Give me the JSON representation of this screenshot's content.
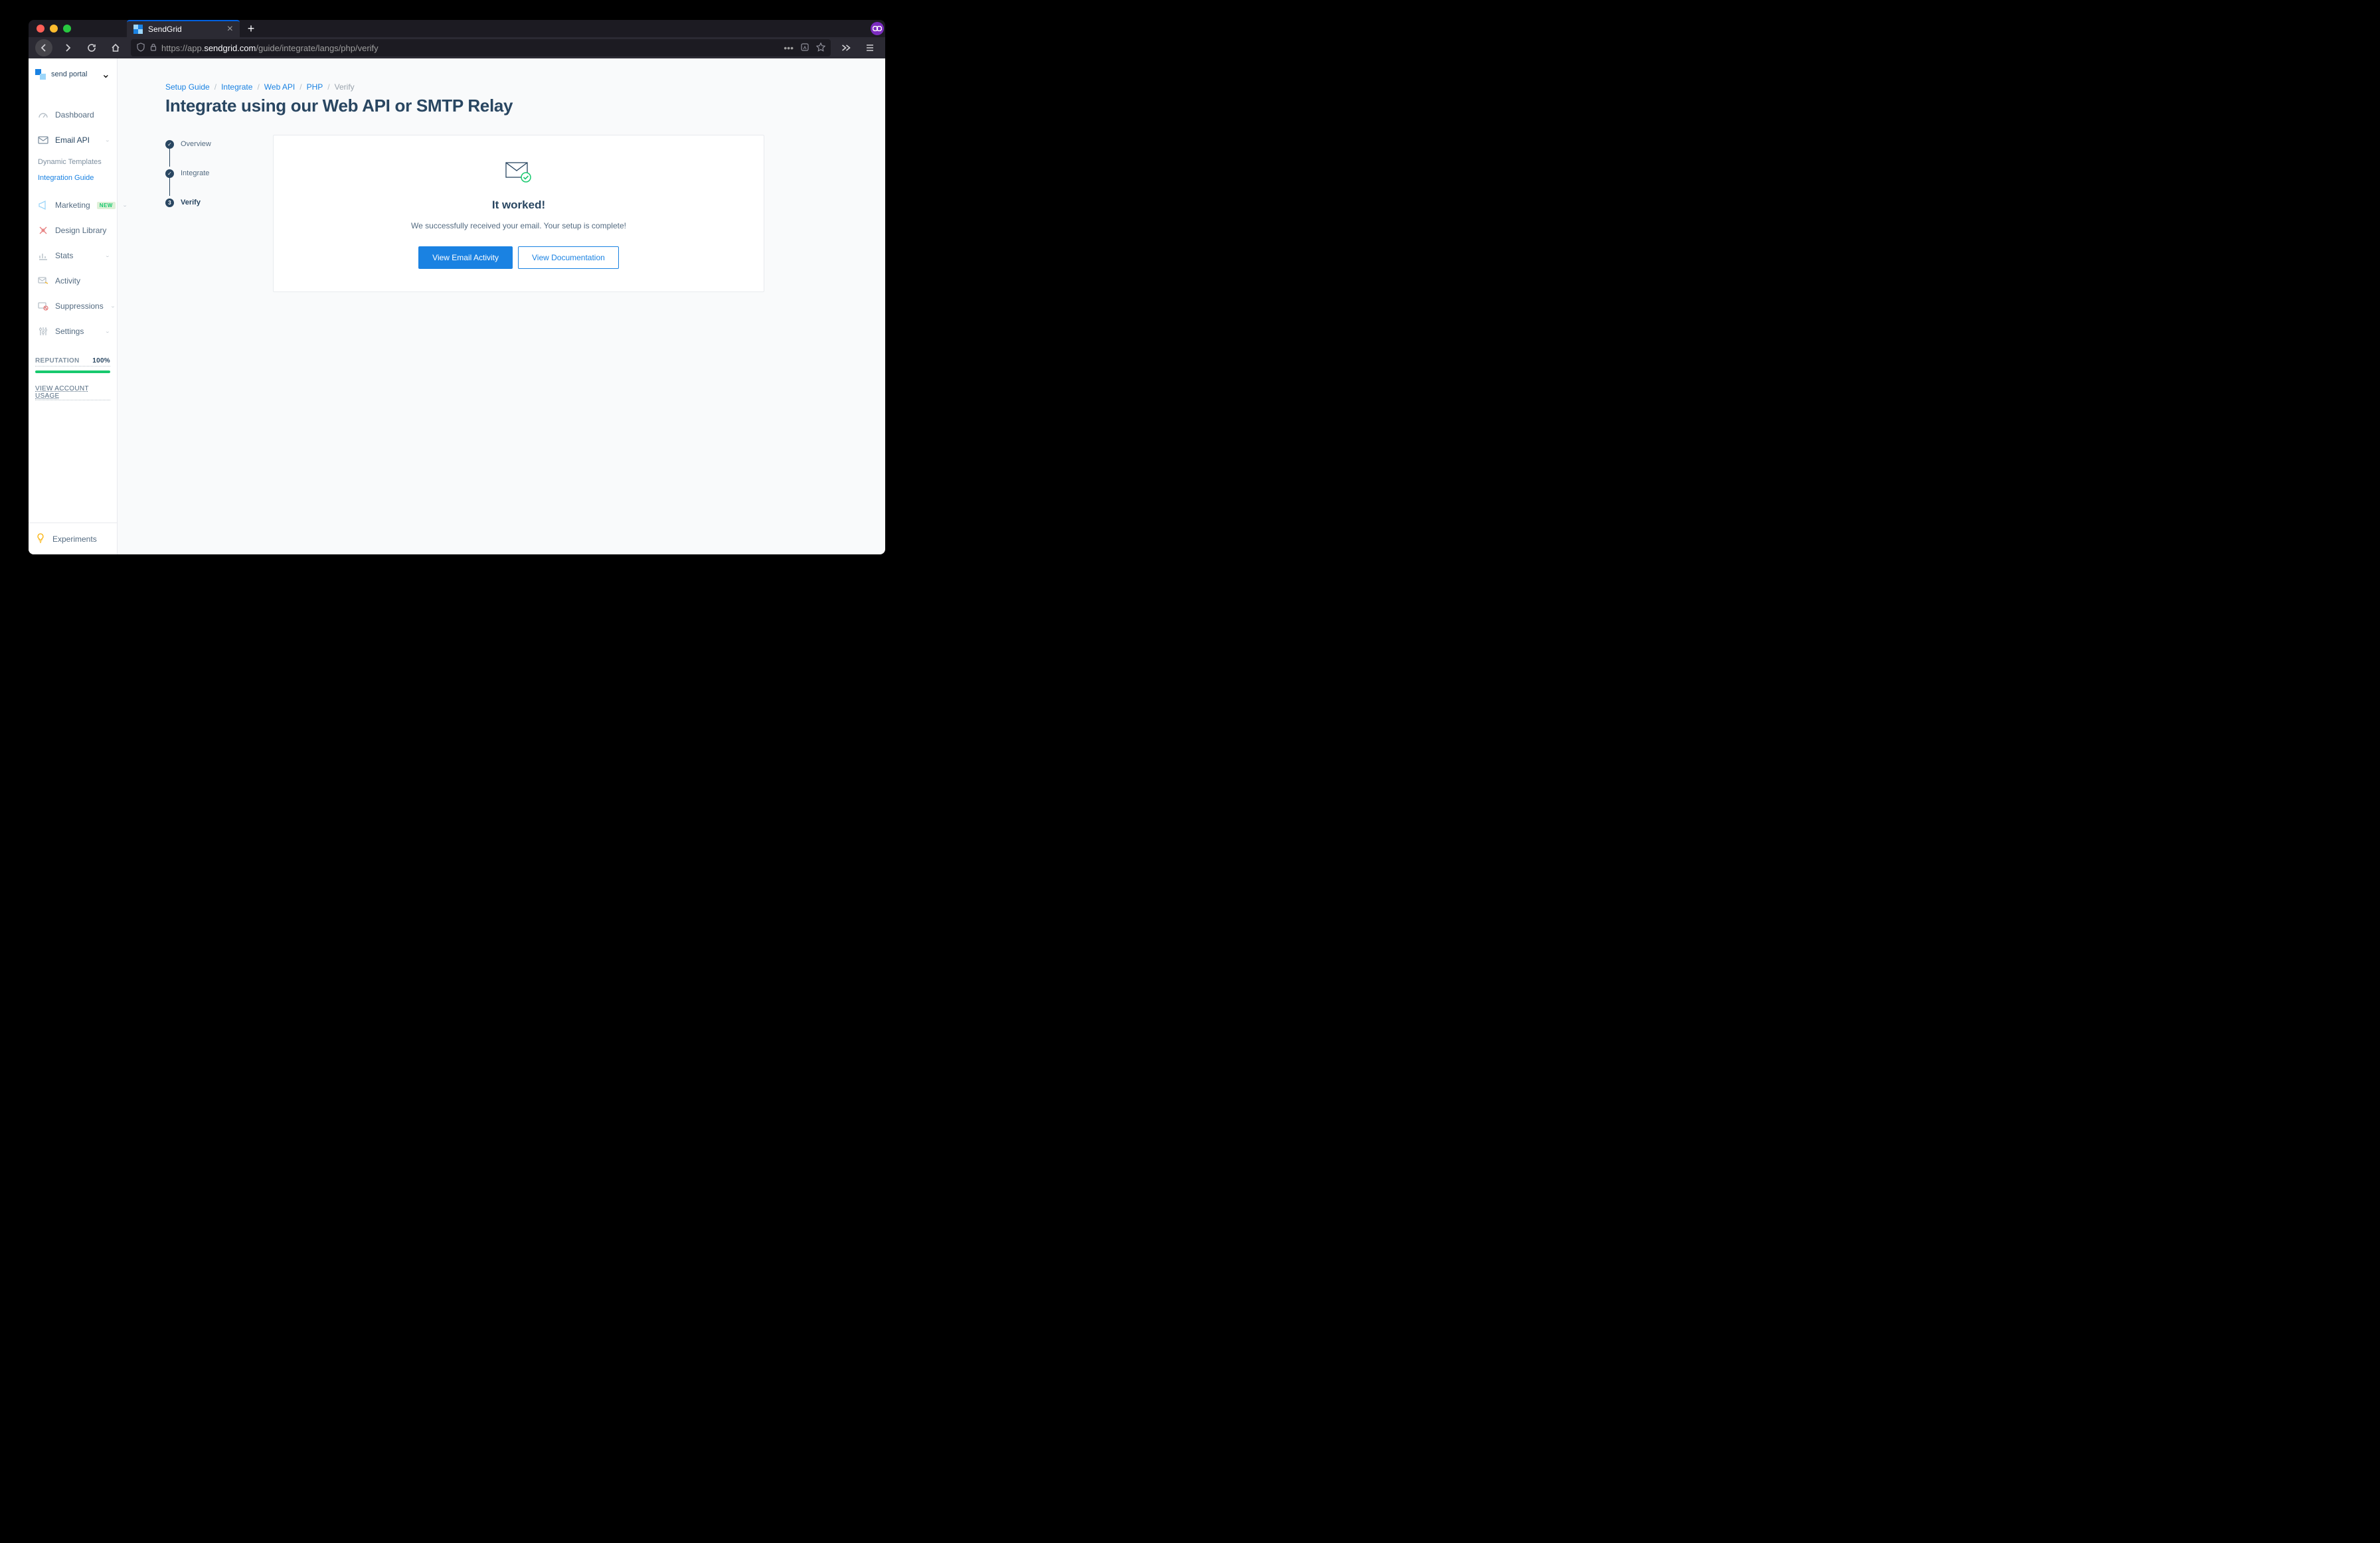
{
  "browser": {
    "tab_title": "SendGrid",
    "url_display_prefix": "https://app.",
    "url_display_domain": "sendgrid.com",
    "url_display_path": "/guide/integrate/langs/php/verify"
  },
  "account": {
    "name": "send portal"
  },
  "sidebar": {
    "items": [
      {
        "label": "Dashboard"
      },
      {
        "label": "Email API"
      },
      {
        "label": "Marketing",
        "badge": "NEW"
      },
      {
        "label": "Design Library"
      },
      {
        "label": "Stats"
      },
      {
        "label": "Activity"
      },
      {
        "label": "Suppressions"
      },
      {
        "label": "Settings"
      }
    ],
    "email_api_sub": [
      {
        "label": "Dynamic Templates"
      },
      {
        "label": "Integration Guide"
      }
    ]
  },
  "reputation": {
    "label": "REPUTATION",
    "value": "100%"
  },
  "account_usage": "VIEW ACCOUNT USAGE",
  "experiments_label": "Experiments",
  "breadcrumb": {
    "items": [
      "Setup Guide",
      "Integrate",
      "Web API",
      "PHP"
    ],
    "current": "Verify"
  },
  "page_title": "Integrate using our Web API or SMTP Relay",
  "steps": [
    {
      "label": "Overview",
      "done": true
    },
    {
      "label": "Integrate",
      "done": true
    },
    {
      "label": "Verify",
      "current": true,
      "num": "3"
    }
  ],
  "card": {
    "heading": "It worked!",
    "desc": "We successfully received your email. Your setup is complete!",
    "primary_btn": "View Email Activity",
    "outline_btn": "View Documentation"
  }
}
